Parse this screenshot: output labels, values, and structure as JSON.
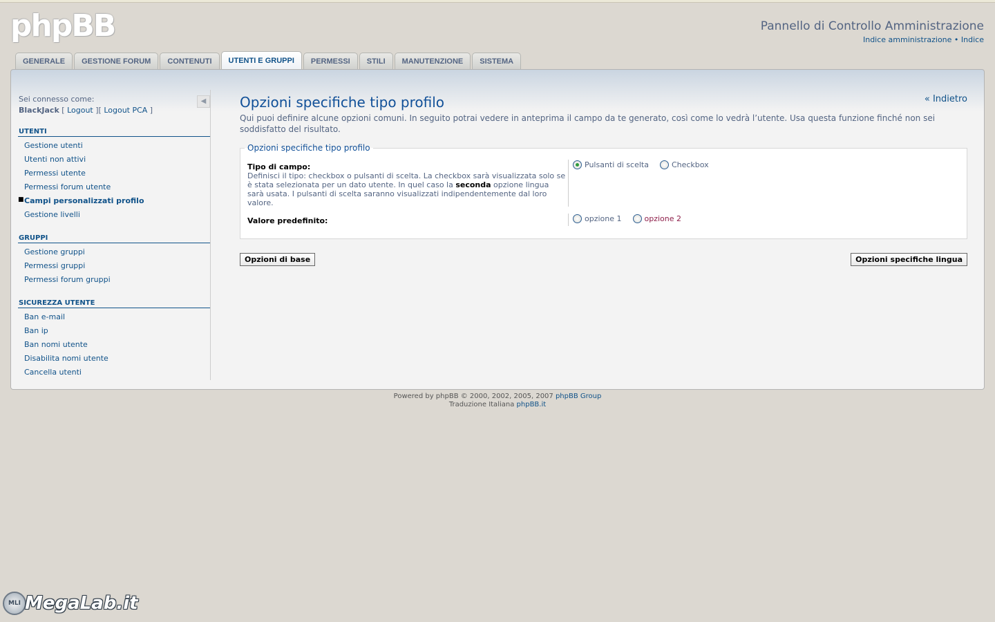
{
  "header": {
    "logo_text": "phpBB",
    "title": "Pannello di Controllo Amministrazione",
    "link_admin_index": "Indice amministrazione",
    "separator": "•",
    "link_index": "Indice"
  },
  "tabs": [
    {
      "label": "GENERALE"
    },
    {
      "label": "GESTIONE FORUM"
    },
    {
      "label": "CONTENUTI"
    },
    {
      "label": "UTENTI E GRUPPI",
      "active": true
    },
    {
      "label": "PERMESSI"
    },
    {
      "label": "STILI"
    },
    {
      "label": "MANUTENZIONE"
    },
    {
      "label": "SISTEMA"
    }
  ],
  "sidebar": {
    "logged_in_as": "Sei connesso come:",
    "username": "BlackJack",
    "logout": "Logout",
    "logout_pca": "Logout PCA",
    "sections": [
      {
        "title": "UTENTI",
        "items": [
          "Gestione utenti",
          "Utenti non attivi",
          "Permessi utente",
          "Permessi forum utente",
          "Campi personalizzati profilo",
          "Gestione livelli"
        ]
      },
      {
        "title": "GRUPPI",
        "items": [
          "Gestione gruppi",
          "Permessi gruppi",
          "Permessi forum gruppi"
        ]
      },
      {
        "title": "SICUREZZA UTENTE",
        "items": [
          "Ban e-mail",
          "Ban ip",
          "Ban nomi utente",
          "Disabilita nomi utente",
          "Cancella utenti"
        ]
      }
    ]
  },
  "main": {
    "title": "Opzioni specifiche tipo profilo",
    "back_link": "« Indietro",
    "description": "Qui puoi definire alcune opzioni comuni. In seguito potrai vedere in anteprima il campo da te generato, così come lo vedrà l’utente. Usa questa funzione finché non sei soddisfatto del risultato.",
    "fieldset": {
      "legend": "Opzioni specifiche tipo profilo",
      "field_type": {
        "label": "Tipo di campo:",
        "explain_1": "Definisci il tipo: checkbox o pulsanti di scelta. La checkbox sarà visualizzata solo se è stata selezionata per un dato utente. In quel caso la ",
        "explain_bold": "seconda",
        "explain_2": " opzione lingua sarà usata. I pulsanti di scelta saranno visualizzati indipendentemente dal loro valore.",
        "option_1": "Pulsanti di scelta",
        "option_2": "Checkbox"
      },
      "default_value": {
        "label": "Valore predefinito:",
        "option_1": "opzione 1",
        "option_2": "opzione 2"
      }
    },
    "btn_basic": "Opzioni di base",
    "btn_lang": "Opzioni specifiche lingua"
  },
  "footer": {
    "powered_by": "Powered by phpBB © 2000, 2002, 2005, 2007 ",
    "phpbb_group": "phpBB Group",
    "translation": "Traduzione Italiana ",
    "phpbb_it": "phpBB.it"
  },
  "watermark": {
    "badge": "MLI",
    "text": "MegaLab.it"
  }
}
